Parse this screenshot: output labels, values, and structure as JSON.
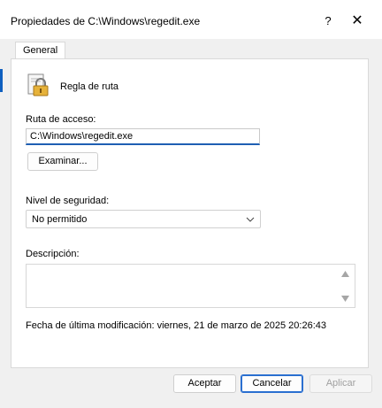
{
  "window": {
    "title": "Propiedades de C:\\Windows\\regedit.exe",
    "help_glyph": "?",
    "close_glyph": "✕"
  },
  "tabs": [
    {
      "label": "General",
      "selected": true
    }
  ],
  "rule": {
    "icon": "lock-document-icon",
    "title": "Regla de ruta"
  },
  "path": {
    "label": "Ruta de acceso:",
    "value": "C:\\Windows\\regedit.exe",
    "browse_label": "Examinar..."
  },
  "security": {
    "label": "Nivel de seguridad:",
    "selected": "No permitido"
  },
  "description": {
    "label": "Descripción:",
    "value": ""
  },
  "modified": {
    "text": "Fecha de última modificación:  viernes, 21 de marzo de 2025  20:26:43"
  },
  "buttons": {
    "ok": "Aceptar",
    "cancel": "Cancelar",
    "apply": "Aplicar"
  },
  "colors": {
    "accent": "#0f5fbf",
    "disabled_text": "#a0a0a0"
  }
}
